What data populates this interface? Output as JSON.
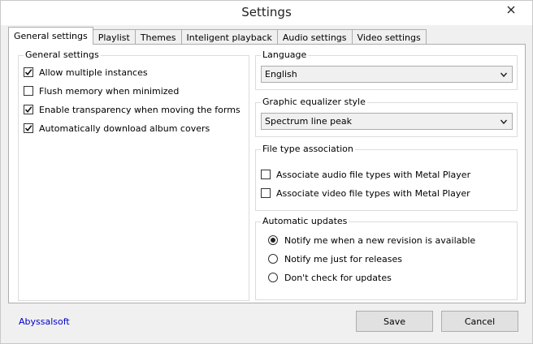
{
  "window": {
    "title": "Settings"
  },
  "tabs": [
    {
      "label": "General settings",
      "active": true
    },
    {
      "label": "Playlist"
    },
    {
      "label": "Themes"
    },
    {
      "label": "Inteligent playback"
    },
    {
      "label": "Audio settings"
    },
    {
      "label": "Video settings"
    }
  ],
  "general": {
    "title": "General settings",
    "options": [
      {
        "label": "Allow multiple instances",
        "checked": true
      },
      {
        "label": "Flush memory when minimized",
        "checked": false
      },
      {
        "label": "Enable transparency when moving the forms",
        "checked": true
      },
      {
        "label": "Automatically download album covers",
        "checked": true
      }
    ]
  },
  "language": {
    "title": "Language",
    "selected": "English"
  },
  "equalizer": {
    "title": "Graphic equalizer style",
    "selected": "Spectrum line peak"
  },
  "filetype": {
    "title": "File type association",
    "options": [
      {
        "label": "Associate audio file types with Metal Player",
        "checked": false
      },
      {
        "label": "Associate video file types with Metal Player",
        "checked": false
      }
    ]
  },
  "updates": {
    "title": "Automatic updates",
    "options": [
      {
        "label": "Notify me when a new revision is available",
        "selected": true
      },
      {
        "label": "Notify me just for releases",
        "selected": false
      },
      {
        "label": "Don't check for updates",
        "selected": false
      }
    ]
  },
  "footer": {
    "link": "Abyssalsoft",
    "save_label": "Save",
    "cancel_label": "Cancel"
  }
}
